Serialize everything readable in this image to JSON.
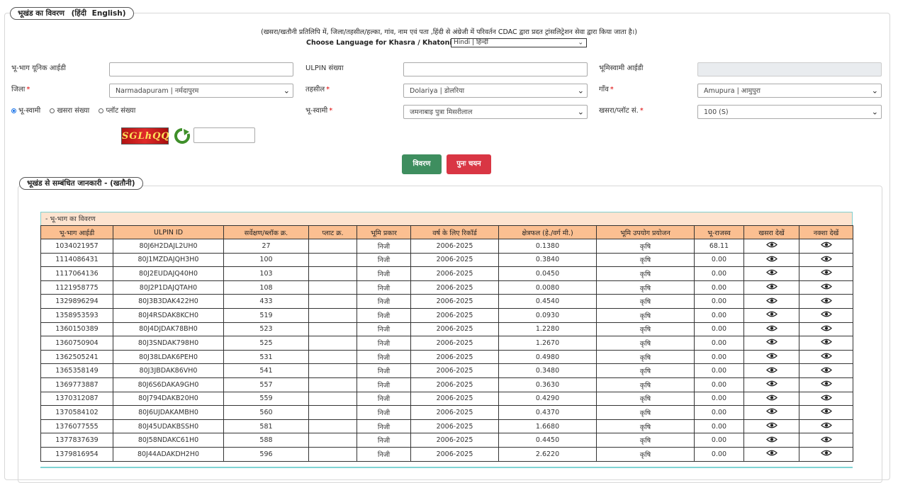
{
  "header": {
    "legend_title": "भूखंड का विवरण",
    "lang_hindi": "(हिंदी",
    "lang_english": "English)"
  },
  "note": "(खसरा/खतौनी प्रतिलिपि में, जिला/तहसील/हल्का, गांव, नाम एवं पता ,हिंदी से अंग्रेजी में परिवर्तन CDAC द्वारा प्रदत ट्रांसलिट्रेशन सेवा द्वारा किया जाता है।)",
  "language": {
    "label": "Choose Language for Khasra / Khatoni Copy:",
    "selected": "Hindi | हिन्दी"
  },
  "form": {
    "unique_id_label": "भू-भाग यूनिक आईडी",
    "unique_id_value": "",
    "ulpin_label": "ULPIN संख्या",
    "ulpin_value": "",
    "owner_id_label": "भूमिस्वामी आईडी",
    "district_label": "जिला",
    "district_value": "Narmadapuram | नर्मदापुरम",
    "tehsil_label": "तहसील",
    "tehsil_value": "Dolariya | डोलरिया",
    "village_label": "गाँव",
    "village_value": "Amupura | आमुपुरा",
    "radio_owner": "भू-स्वामी",
    "radio_khasra": "खसरा संख्या",
    "radio_plot": "प्लॉट संख्या",
    "owner_label": "भू-स्वामी",
    "owner_value": "जमनाबाइ पुत्रा मिसरीलाल",
    "khasra_label": "खसरा/प्लॉट सं.",
    "khasra_value": "100 (S)",
    "captcha_text": "SGLhQQ",
    "captcha_input": ""
  },
  "buttons": {
    "view": "विवरण देखे",
    "reset": "पुनः चयन करे"
  },
  "section": {
    "legend": "भूखंड से सम्बंधित जानकारी -  (खतौनी)",
    "caption": "- भू-भाग का विवरण"
  },
  "table": {
    "headers": [
      "भू-भाग आईडी",
      "ULPIN ID",
      "सर्वेक्षण/ब्लॉक क्र.",
      "प्लाट क्र.",
      "भूमि प्रकार",
      "वर्ष के लिए रिकॉर्ड",
      "क्षेत्रफल (हे./वर्ग मी.)",
      "भूमि उपयोग प्रयोजन",
      "भू-राजस्व",
      "खसरा देखें",
      "नक्शा देखें"
    ],
    "rows": [
      [
        "1034021957",
        "80J6H2DAJL2UH0",
        "27",
        "",
        "निजी",
        "2006-2025",
        "0.1380",
        "कृषि",
        "68.11"
      ],
      [
        "1114086431",
        "80J1MZDAJQH3H0",
        "100",
        "",
        "निजी",
        "2006-2025",
        "0.3840",
        "कृषि",
        "0.00"
      ],
      [
        "1117064136",
        "80J2EUDAJQ40H0",
        "103",
        "",
        "निजी",
        "2006-2025",
        "0.0450",
        "कृषि",
        "0.00"
      ],
      [
        "1121958775",
        "80J2P1DAJQTAH0",
        "108",
        "",
        "निजी",
        "2006-2025",
        "0.0080",
        "कृषि",
        "0.00"
      ],
      [
        "1329896294",
        "80J3B3DAK422H0",
        "433",
        "",
        "निजी",
        "2006-2025",
        "0.4540",
        "कृषि",
        "0.00"
      ],
      [
        "1358953593",
        "80J4RSDAK8KCH0",
        "519",
        "",
        "निजी",
        "2006-2025",
        "0.0930",
        "कृषि",
        "0.00"
      ],
      [
        "1360150389",
        "80J4DJDAK78BH0",
        "523",
        "",
        "निजी",
        "2006-2025",
        "1.2280",
        "कृषि",
        "0.00"
      ],
      [
        "1360750904",
        "80J3SNDAK798H0",
        "525",
        "",
        "निजी",
        "2006-2025",
        "1.2670",
        "कृषि",
        "0.00"
      ],
      [
        "1362505241",
        "80J38LDAK6PEH0",
        "531",
        "",
        "निजी",
        "2006-2025",
        "0.4980",
        "कृषि",
        "0.00"
      ],
      [
        "1365358149",
        "80J3JBDAK86VH0",
        "541",
        "",
        "निजी",
        "2006-2025",
        "0.3480",
        "कृषि",
        "0.00"
      ],
      [
        "1369773887",
        "80J6S6DAKA9GH0",
        "557",
        "",
        "निजी",
        "2006-2025",
        "0.3630",
        "कृषि",
        "0.00"
      ],
      [
        "1370312087",
        "80J794DAKB20H0",
        "559",
        "",
        "निजी",
        "2006-2025",
        "0.4290",
        "कृषि",
        "0.00"
      ],
      [
        "1370584102",
        "80J6UJDAKAMBH0",
        "560",
        "",
        "निजी",
        "2006-2025",
        "0.4370",
        "कृषि",
        "0.00"
      ],
      [
        "1376077555",
        "80J45UDAKBSSH0",
        "581",
        "",
        "निजी",
        "2006-2025",
        "1.6680",
        "कृषि",
        "0.00"
      ],
      [
        "1377837639",
        "80J58NDAKC61H0",
        "588",
        "",
        "निजी",
        "2006-2025",
        "0.4450",
        "कृषि",
        "0.00"
      ],
      [
        "1379816954",
        "80J44ADAKDH2H0",
        "596",
        "",
        "निजी",
        "2006-2025",
        "2.6220",
        "कृषि",
        "0.00"
      ]
    ],
    "action_icon": "eye-icon"
  }
}
